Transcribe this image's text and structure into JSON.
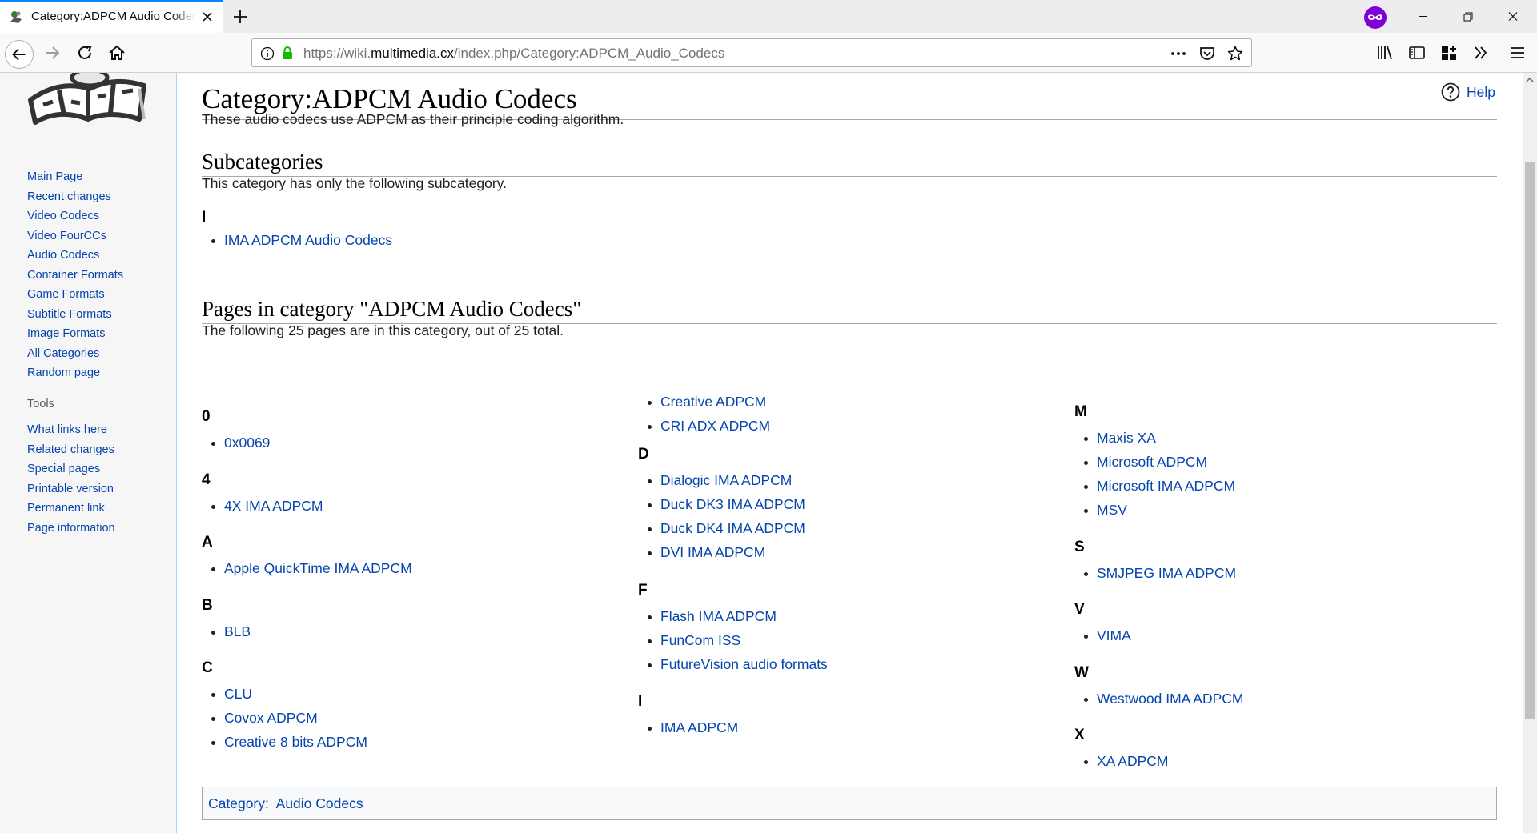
{
  "browser": {
    "tab_title": "Category:ADPCM Audio Codecs",
    "url": {
      "prefix": "https://wiki.",
      "domain": "multimedia.cx",
      "path": "/index.php/Category:ADPCM_Audio_Codecs"
    }
  },
  "sidebar": {
    "navigation": [
      "Main Page",
      "Recent changes",
      "Video Codecs",
      "Video FourCCs",
      "Audio Codecs",
      "Container Formats",
      "Game Formats",
      "Subtitle Formats",
      "Image Formats",
      "All Categories",
      "Random page"
    ],
    "tools_heading": "Tools",
    "tools": [
      "What links here",
      "Related changes",
      "Special pages",
      "Printable version",
      "Permanent link",
      "Page information"
    ]
  },
  "content": {
    "help": "Help",
    "title": "Category:ADPCM Audio Codecs",
    "intro": "These audio codecs use ADPCM as their principle coding algorithm.",
    "subcategories": {
      "heading": "Subcategories",
      "note": "This category has only the following subcategory.",
      "letter": "I",
      "items": [
        "IMA ADPCM Audio Codecs"
      ]
    },
    "pages": {
      "heading": "Pages in category \"ADPCM Audio Codecs\"",
      "note": "The following 25 pages are in this category, out of 25 total.",
      "col1": [
        {
          "letter": "0",
          "items": [
            "0x0069"
          ]
        },
        {
          "letter": "4",
          "items": [
            "4X IMA ADPCM"
          ]
        },
        {
          "letter": "A",
          "items": [
            "Apple QuickTime IMA ADPCM"
          ]
        },
        {
          "letter": "B",
          "items": [
            "BLB"
          ]
        },
        {
          "letter": "C",
          "items": [
            "CLU",
            "Covox ADPCM",
            "Creative 8 bits ADPCM"
          ]
        }
      ],
      "col2_cont": [
        "Creative ADPCM",
        "CRI ADX ADPCM"
      ],
      "col2": [
        {
          "letter": "D",
          "items": [
            "Dialogic IMA ADPCM",
            "Duck DK3 IMA ADPCM",
            "Duck DK4 IMA ADPCM",
            "DVI IMA ADPCM"
          ]
        },
        {
          "letter": "F",
          "items": [
            "Flash IMA ADPCM",
            "FunCom ISS",
            "FutureVision audio formats"
          ]
        },
        {
          "letter": "I",
          "items": [
            "IMA ADPCM"
          ]
        }
      ],
      "col3": [
        {
          "letter": "M",
          "items": [
            "Maxis XA",
            "Microsoft ADPCM",
            "Microsoft IMA ADPCM",
            "MSV"
          ]
        },
        {
          "letter": "S",
          "items": [
            "SMJPEG IMA ADPCM"
          ]
        },
        {
          "letter": "V",
          "items": [
            "VIMA"
          ]
        },
        {
          "letter": "W",
          "items": [
            "Westwood IMA ADPCM"
          ]
        },
        {
          "letter": "X",
          "items": [
            "XA ADPCM"
          ]
        }
      ]
    },
    "catlinks": {
      "label": "Category",
      "separator": ":",
      "items": [
        "Audio Codecs"
      ]
    }
  }
}
